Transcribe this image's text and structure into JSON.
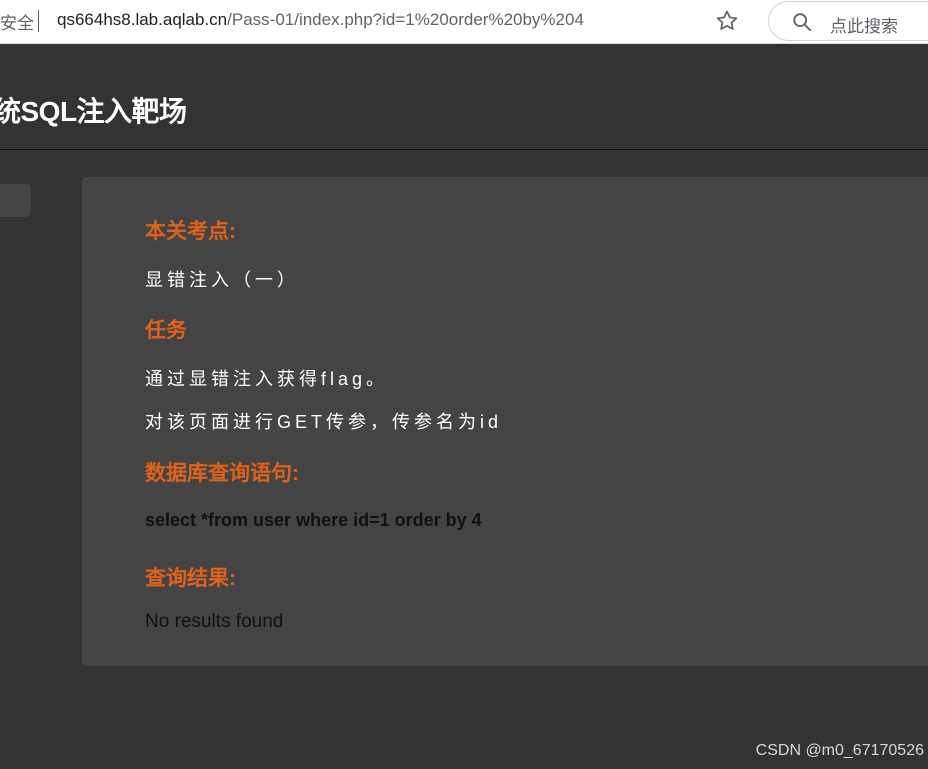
{
  "browser": {
    "security_label": "安全",
    "url_host": "qs664hs8.lab.aqlab.cn",
    "url_path": "/Pass-01/index.php?id=1%20order%20by%204",
    "search_placeholder": "点此搜索"
  },
  "header": {
    "title": "统SQL注入靶场"
  },
  "content": {
    "sections": [
      {
        "heading": "本关考点:",
        "lines": [
          "显错注入（一）"
        ]
      },
      {
        "heading": "任务",
        "lines": [
          "通过显错注入获得flag。",
          "对该页面进行GET传参，传参名为id"
        ]
      },
      {
        "heading": "数据库查询语句:",
        "query": "select *from user where id=1 order by 4"
      },
      {
        "heading": "查询结果:",
        "result": "No results found"
      }
    ]
  },
  "watermark": "CSDN @m0_67170526",
  "colors": {
    "accent": "#e0621a",
    "page_bg": "#333333",
    "panel_bg": "#444444"
  },
  "icons": [
    "star-icon",
    "search-icon"
  ]
}
